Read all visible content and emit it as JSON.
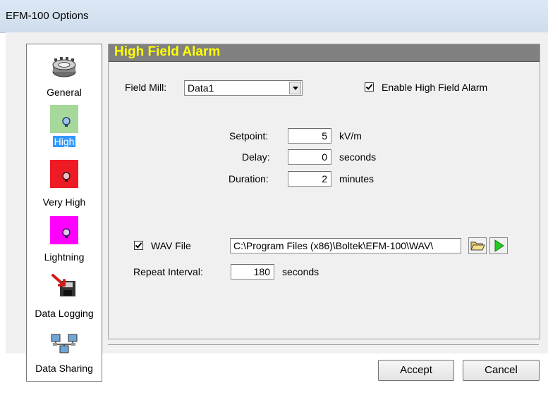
{
  "window": {
    "title": "EFM-100 Options"
  },
  "nav": {
    "items": [
      {
        "label": "General",
        "icon": "gear-icon"
      },
      {
        "label": "High",
        "icon": "green-alarm-icon",
        "selected": true
      },
      {
        "label": "Very High",
        "icon": "red-alarm-icon"
      },
      {
        "label": "Lightning",
        "icon": "magenta-alarm-icon"
      },
      {
        "label": "Data Logging",
        "icon": "floppy-disk-icon"
      },
      {
        "label": "Data Sharing",
        "icon": "network-icon"
      }
    ]
  },
  "panel": {
    "title": "High Field Alarm",
    "field_mill_label": "Field Mill:",
    "field_mill_value": "Data1",
    "enable_label": "Enable High Field Alarm",
    "enable_checked": true,
    "setpoint_label": "Setpoint:",
    "setpoint_value": "5",
    "setpoint_unit": "kV/m",
    "delay_label": "Delay:",
    "delay_value": "0",
    "delay_unit": "seconds",
    "duration_label": "Duration:",
    "duration_value": "2",
    "duration_unit": "minutes",
    "wav_label": "WAV File",
    "wav_checked": true,
    "wav_path": "C:\\Program Files (x86)\\Boltek\\EFM-100\\WAV\\",
    "repeat_label": "Repeat Interval:",
    "repeat_value": "180",
    "repeat_unit": "seconds"
  },
  "buttons": {
    "accept": "Accept",
    "cancel": "Cancel"
  },
  "colors": {
    "header_bg": "#808080",
    "header_text": "#ffff00",
    "selected_bg": "#3399ff",
    "high": "#a6d89a",
    "very_high": "#ee1b24",
    "lightning": "#ff00ff",
    "play": "#22cc22"
  }
}
